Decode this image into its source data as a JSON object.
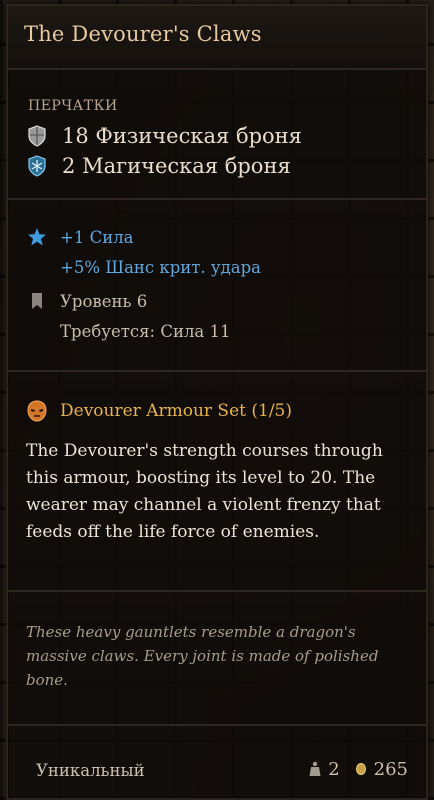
{
  "item": {
    "name": "The Devourer's Claws",
    "category": "ПЕРЧАТКИ",
    "armor": [
      {
        "icon": "shield-icon",
        "value": "18",
        "label": "Физическая броня"
      },
      {
        "icon": "snowflake-icon",
        "value": "2",
        "label": "Магическая броня"
      }
    ],
    "bonuses": {
      "primary": "+1 Сила",
      "secondary": "+5% Шанс крит. удара"
    },
    "level_label": "Уровень 6",
    "requirement": "Требуется: Сила 11",
    "set": {
      "title": "Devourer Armour Set (1/5)",
      "description": "The Devourer's strength courses through this armour, boosting its level to 20. The wearer may channel a violent frenzy that feeds off the life force of enemies."
    },
    "flavor": "These heavy gauntlets resemble a dragon's massive claws. Every joint is made of polished bone.",
    "rarity": "Уникальный",
    "weight": "2",
    "value": "265"
  },
  "colors": {
    "title": "#e8c8a0",
    "bonus_blue": "#5fa7dd",
    "set_gold": "#e9b44c",
    "text": "#ece4d6"
  }
}
